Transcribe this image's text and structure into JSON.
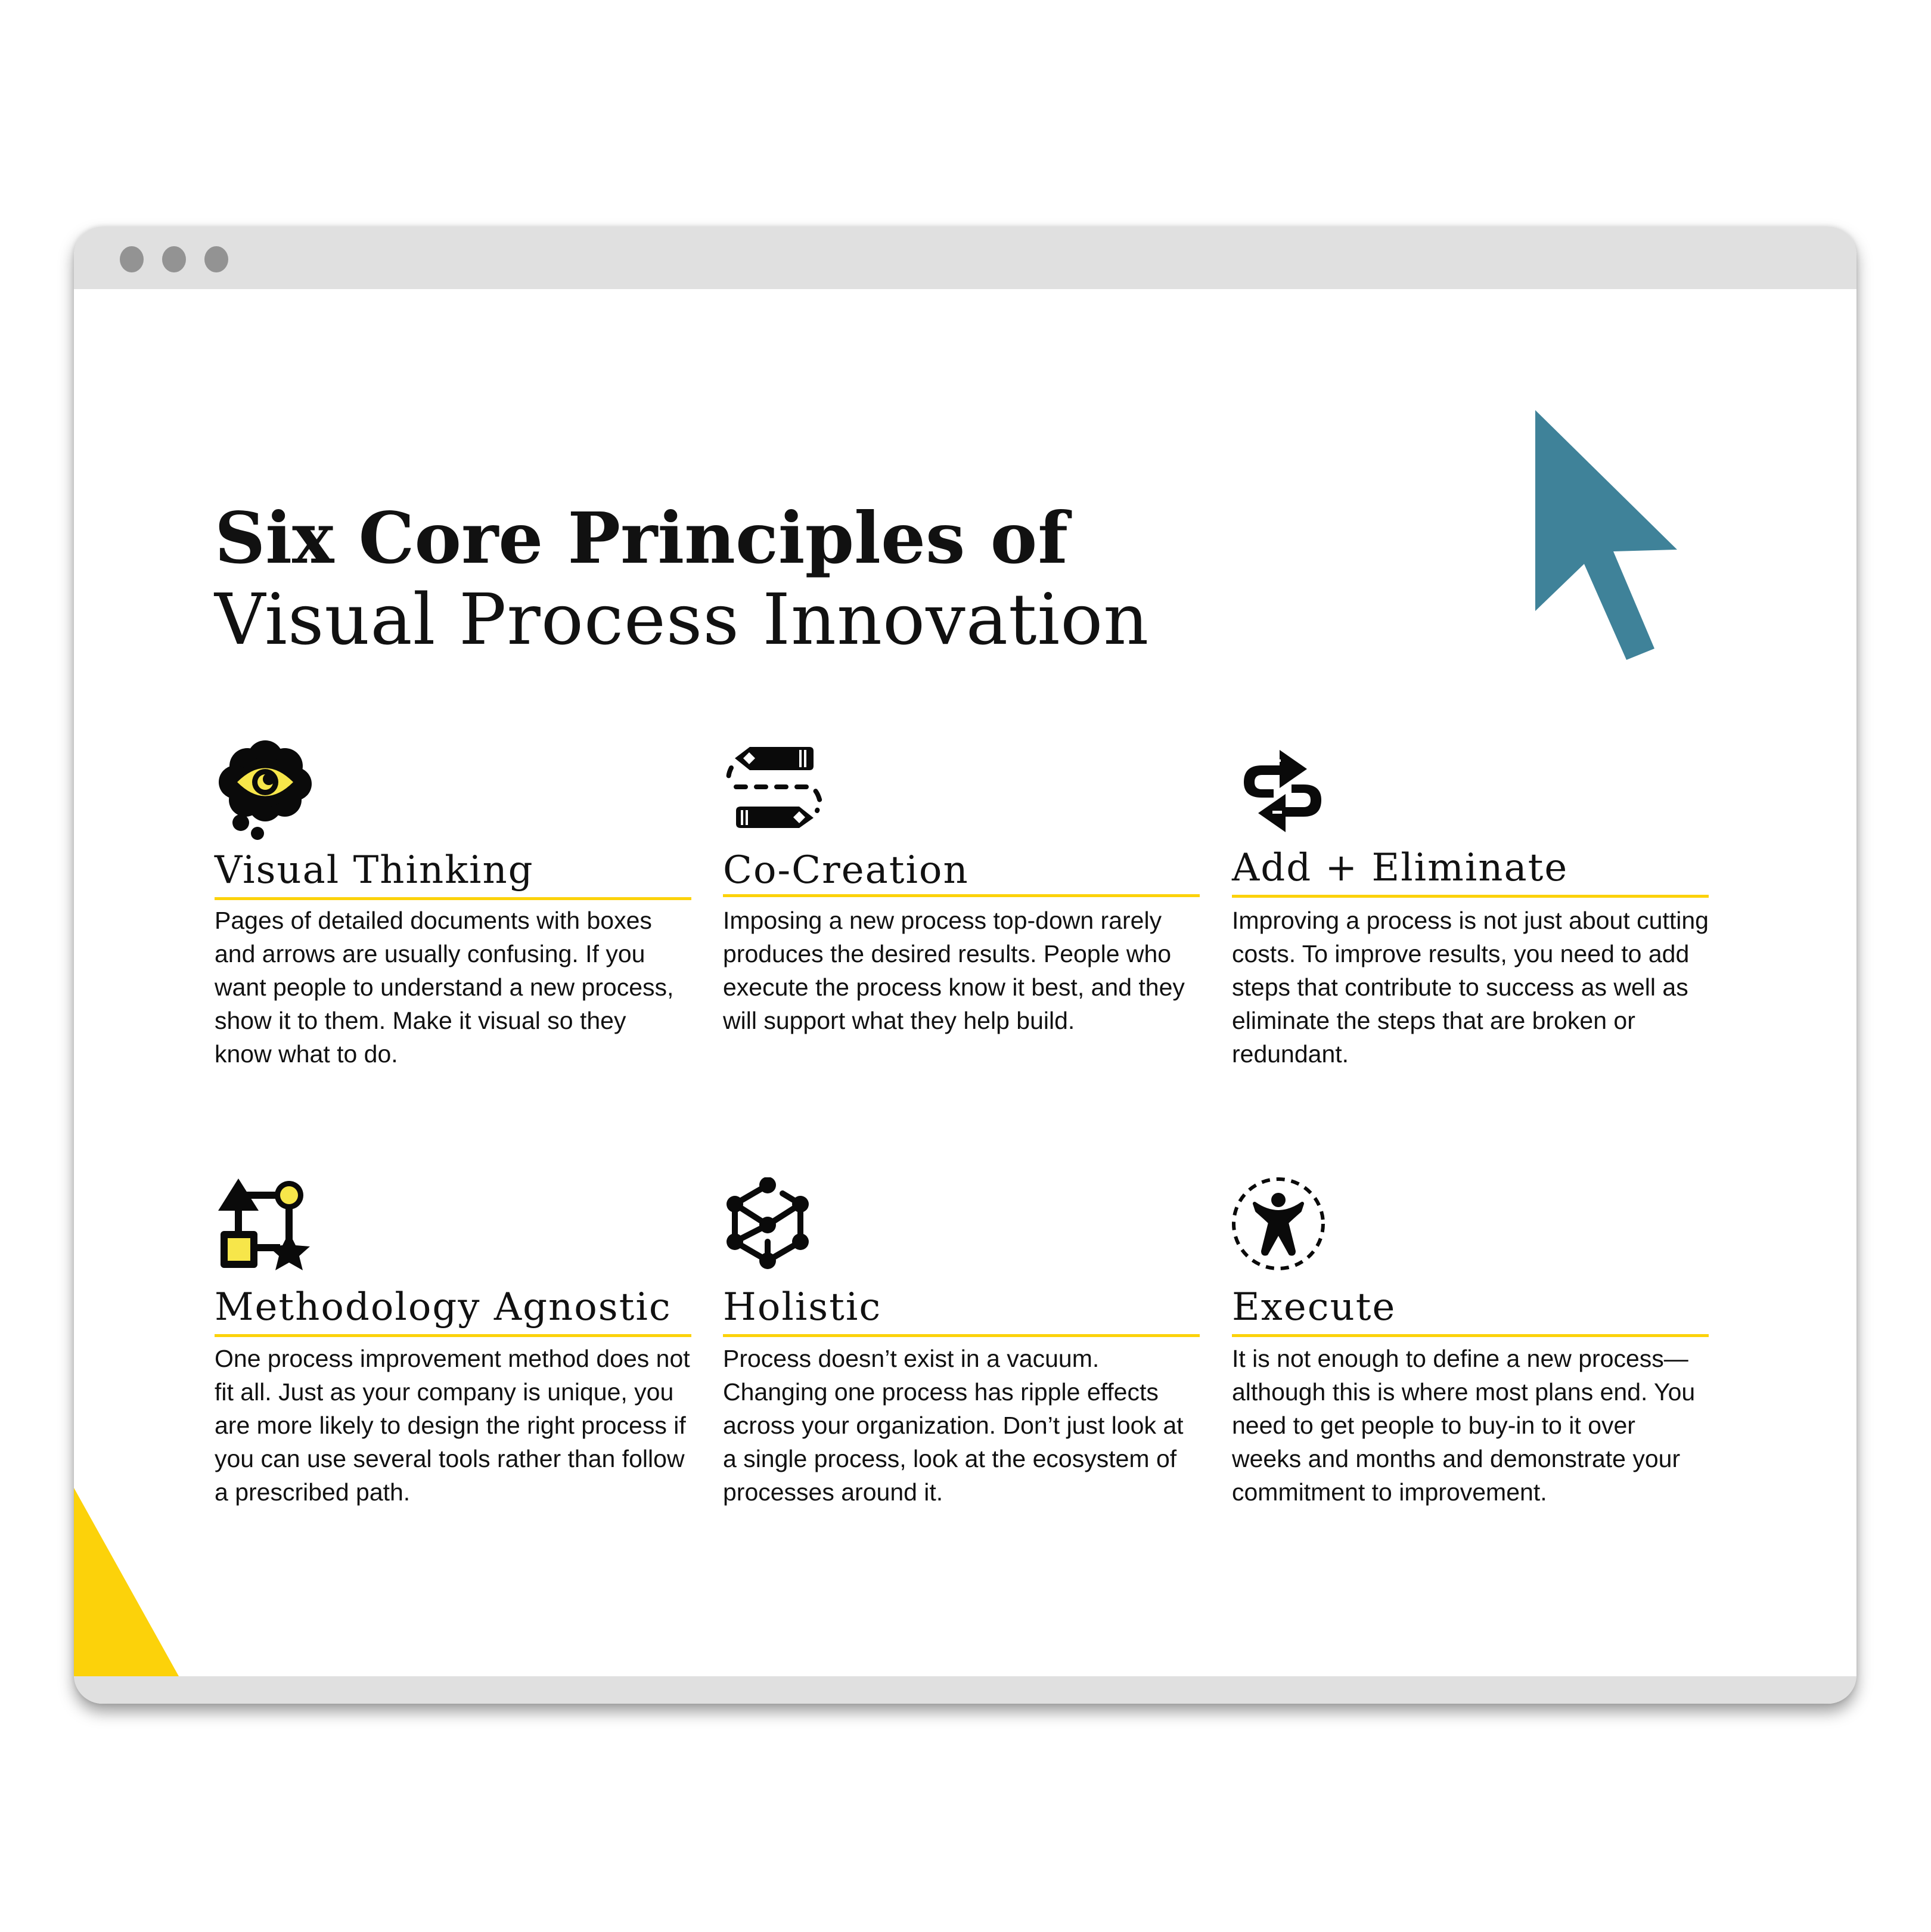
{
  "window": {
    "controls": [
      "window-dot",
      "window-dot",
      "window-dot"
    ],
    "accent_color": "#fcd20a",
    "cursor_color": "#3f8299"
  },
  "title": {
    "bold": "Six Core Principles",
    "connector": "of",
    "line2": "Visual Process Innovation"
  },
  "principles": [
    {
      "icon": "thought-bubble-eye-icon",
      "heading": "Visual Thinking",
      "body": "Pages of detailed documents with boxes and arrows are usually confusing. If you want people to understand a new process, show it to them. Make it visual so they know what to do."
    },
    {
      "icon": "pencils-dashed-path-icon",
      "heading": "Co-Creation",
      "body": "Imposing a new process top-down rarely produces the desired results. People who execute the process know it best, and they will support what they help build."
    },
    {
      "icon": "add-eliminate-arrows-icon",
      "heading": "Add + Eliminate",
      "body": "Improving a process is not just about cutting costs. To improve results, you need to add steps that contribute to success as well as eliminate the steps that are broken or redundant."
    },
    {
      "icon": "shapes-connected-icon",
      "heading": "Methodology Agnostic",
      "body": "One process improvement method does not fit all. Just as your company is unique, you are more likely to design the right process if you can use several tools rather than follow a prescribed path."
    },
    {
      "icon": "network-cube-icon",
      "heading": "Holistic",
      "body": "Process doesn’t exist in a vacuum. Changing one process has ripple effects across your organization. Don’t just look at a single process, look at the ecosystem of processes around it."
    },
    {
      "icon": "person-dashed-circle-icon",
      "heading": "Execute",
      "body": "It is not enough to define a new process—although this is where most plans end. You need to get people to buy-in to it over weeks and months and demonstrate your commitment to improvement."
    }
  ]
}
